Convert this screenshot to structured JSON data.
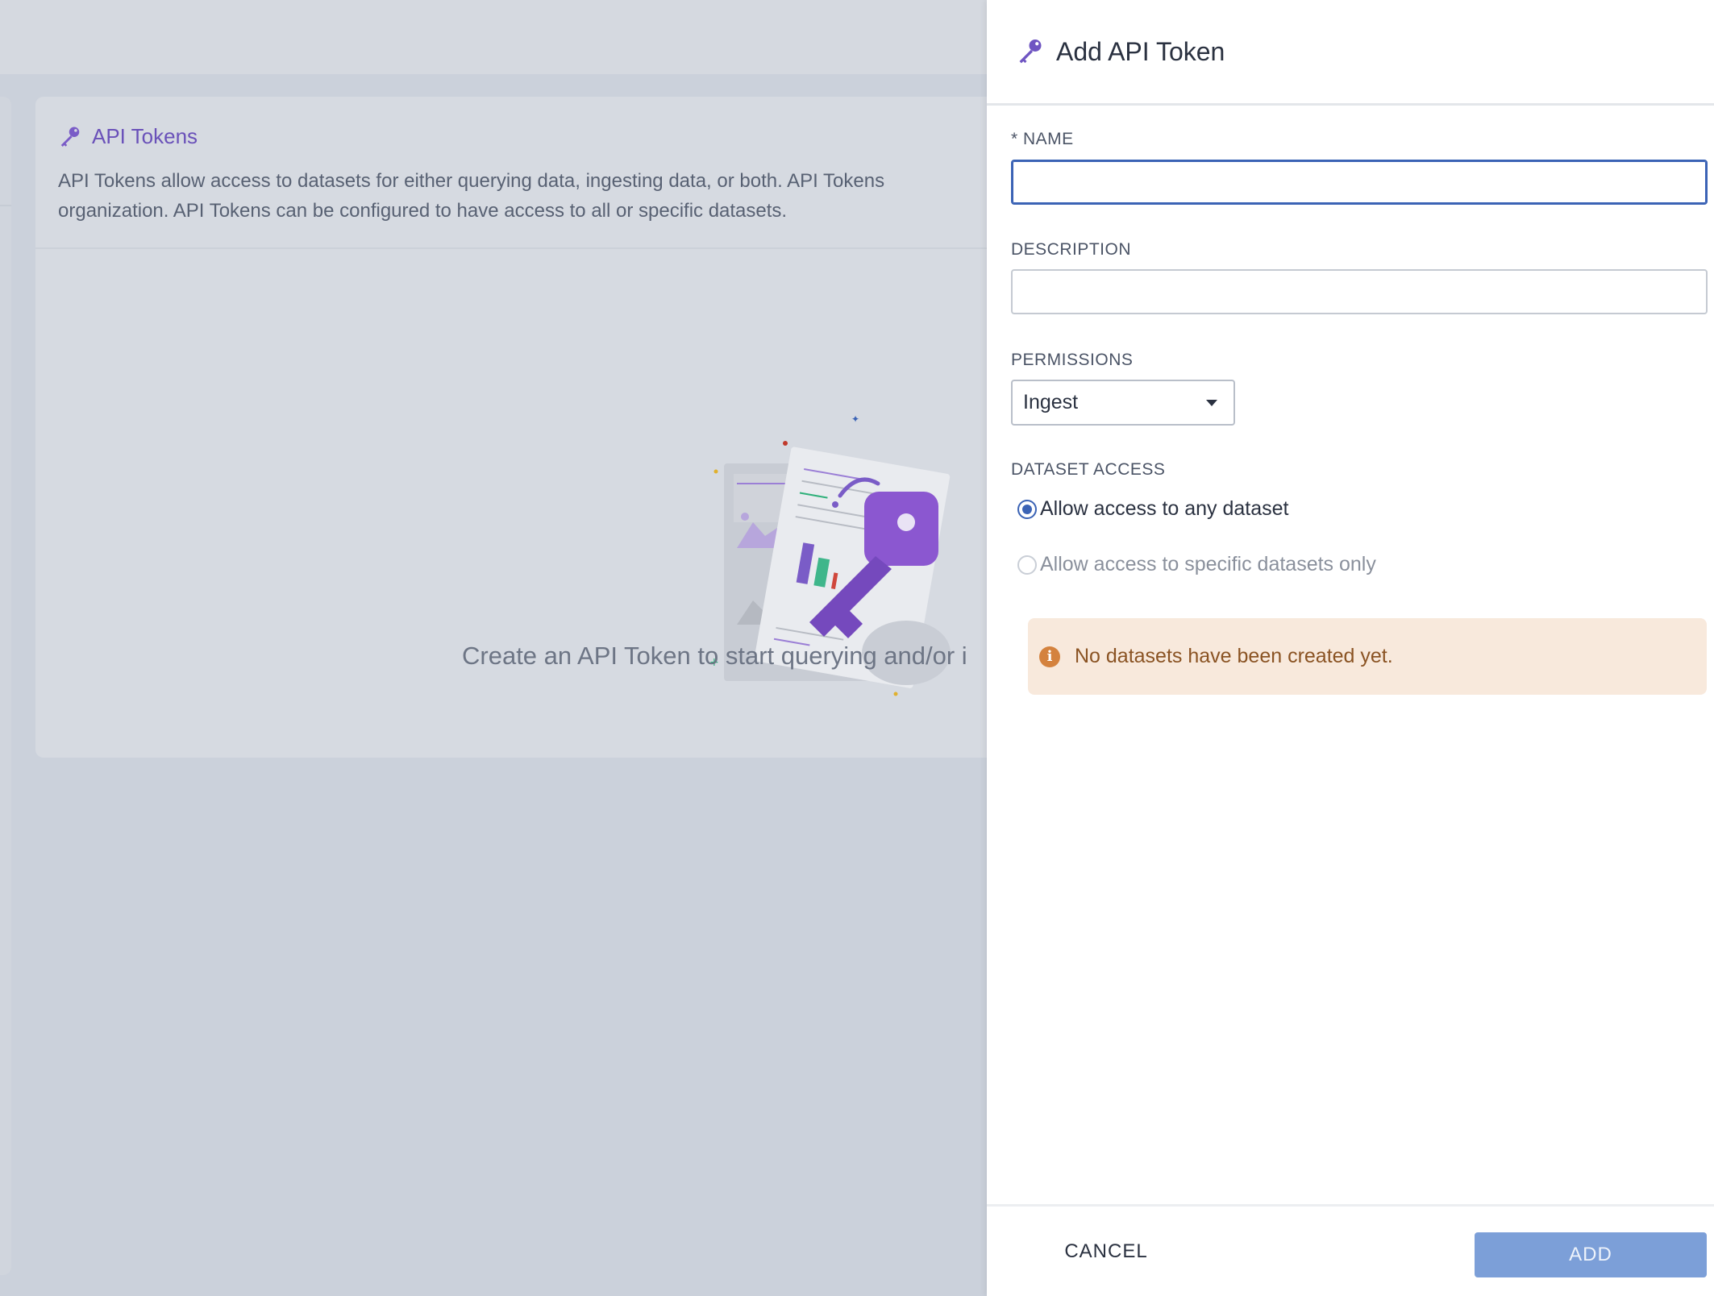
{
  "background": {
    "card_title": "API Tokens",
    "card_description": "API Tokens allow access to datasets for either querying data, ingesting data, or both. API Tokens\norganization. API Tokens can be configured to have access to all or specific datasets.",
    "empty_state_text": "Create an API Token to start querying and/or i"
  },
  "drawer": {
    "title": "Add API Token",
    "name_label": "* NAME",
    "name_value": "",
    "description_label": "DESCRIPTION",
    "description_value": "",
    "permissions_label": "PERMISSIONS",
    "permissions_selected": "Ingest",
    "dataset_access_label": "DATASET ACCESS",
    "radio_any": "Allow access to any dataset",
    "radio_specific": "Allow access to specific datasets only",
    "alert_text": "No datasets have been created yet.",
    "cancel_label": "CANCEL",
    "add_label": "ADD"
  },
  "colors": {
    "accent": "#3b63b5",
    "brand_purple": "#6a51b9",
    "primary_disabled": "#7c9fd8",
    "warning_bg": "#f8e9dc",
    "warning_text": "#8a5323"
  },
  "icons": {
    "title_icon": "key-icon",
    "alert_icon": "info-icon",
    "select_icon": "caret-down-icon"
  }
}
